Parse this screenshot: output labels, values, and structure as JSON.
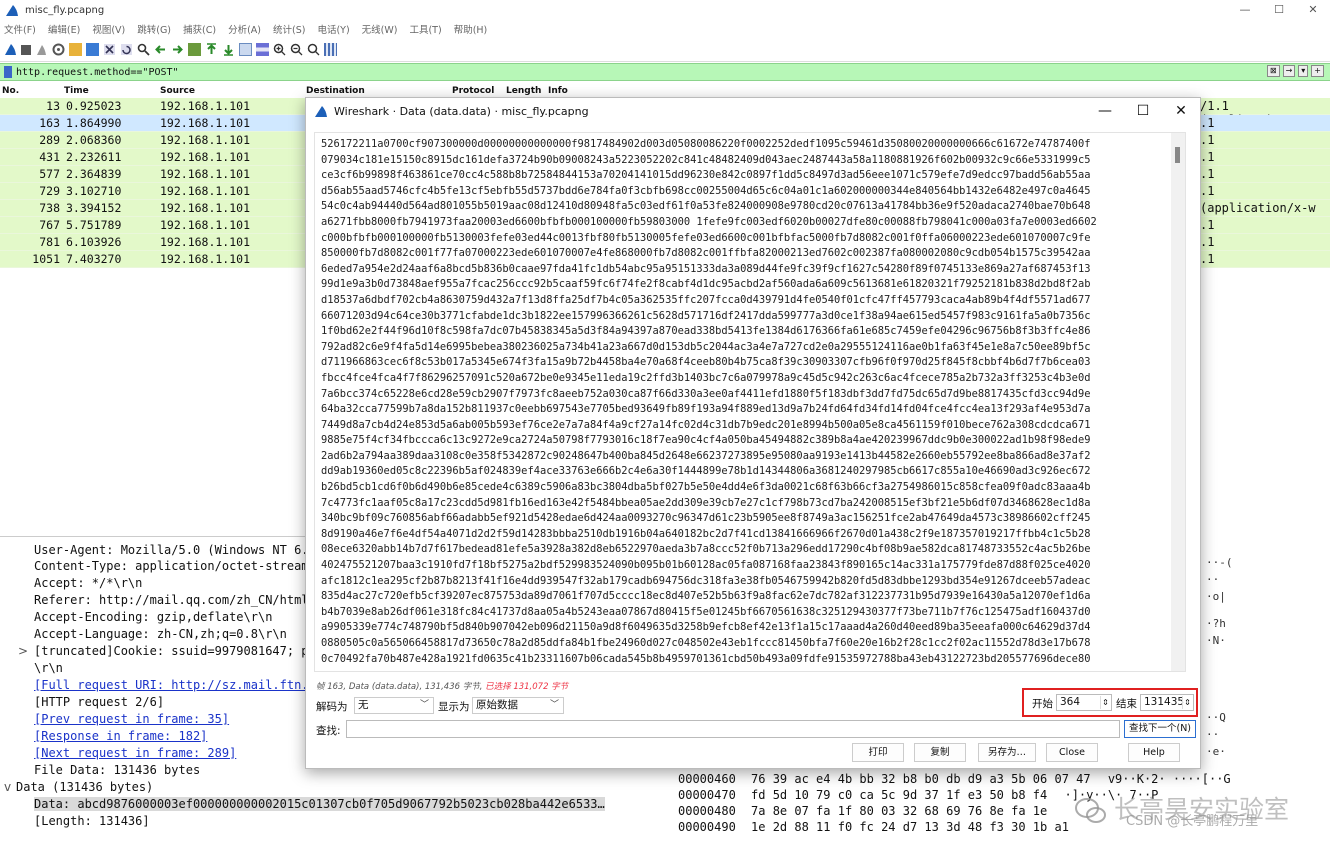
{
  "window": {
    "title": "misc_fly.pcapng",
    "controls": [
      "—",
      "☐",
      "✕"
    ]
  },
  "menu": [
    "文件(F)",
    "编辑(E)",
    "视图(V)",
    "跳转(G)",
    "捕获(C)",
    "分析(A)",
    "统计(S)",
    "电话(Y)",
    "无线(W)",
    "工具(T)",
    "帮助(H)"
  ],
  "filter": {
    "value": "http.request.method==\"POST\"",
    "right_buttons": [
      "⊠",
      "→",
      "▾",
      "+"
    ]
  },
  "columns": [
    "No.",
    "Time",
    "Source",
    "Destination",
    "Protocol",
    "Length",
    "Info"
  ],
  "packets": [
    {
      "no": "13",
      "time": "0.925023",
      "src": "192.168.1.101",
      "info": "/1.1  (application/"
    },
    {
      "no": "163",
      "time": "1.864990",
      "src": "192.168.1.101",
      "info": ".1"
    },
    {
      "no": "289",
      "time": "2.068360",
      "src": "192.168.1.101",
      "info": ".1"
    },
    {
      "no": "431",
      "time": "2.232611",
      "src": "192.168.1.101",
      "info": ".1"
    },
    {
      "no": "577",
      "time": "2.364839",
      "src": "192.168.1.101",
      "info": ".1"
    },
    {
      "no": "729",
      "time": "3.102710",
      "src": "192.168.1.101",
      "info": ".1"
    },
    {
      "no": "738",
      "time": "3.394152",
      "src": "192.168.1.101",
      "info": "  (application/x-w"
    },
    {
      "no": "767",
      "time": "5.751789",
      "src": "192.168.1.101",
      "info": ".1"
    },
    {
      "no": "781",
      "time": "6.103926",
      "src": "192.168.1.101",
      "info": ".1"
    },
    {
      "no": "1051",
      "time": "7.403270",
      "src": "192.168.1.101",
      "info": ".1"
    }
  ],
  "details": [
    {
      "text": "User-Agent: Mozilla/5.0 (Windows NT 6.1",
      "kind": "plain"
    },
    {
      "text": "Content-Type: application/octet-stream\\",
      "kind": "plain"
    },
    {
      "text": "Accept: */*\\r\\n",
      "kind": "plain"
    },
    {
      "text": "Referer: http://mail.qq.com/zh_CN/htmle",
      "kind": "plain"
    },
    {
      "text": "Accept-Encoding: gzip,deflate\\r\\n",
      "kind": "plain"
    },
    {
      "text": "Accept-Language: zh-CN,zh;q=0.8\\r\\n",
      "kind": "plain"
    },
    {
      "text": "[truncated]Cookie: ssuid=9979081647; p",
      "kind": "expand"
    },
    {
      "text": "\\r\\n",
      "kind": "plain"
    },
    {
      "text": "[Full request URI: http://sz.mail.ftn.q",
      "kind": "link"
    },
    {
      "text": "[HTTP request 2/6]",
      "kind": "plain"
    },
    {
      "text": "[Prev request in frame: 35]",
      "kind": "link"
    },
    {
      "text": "[Response in frame: 182]",
      "kind": "link"
    },
    {
      "text": "[Next request in frame: 289]",
      "kind": "link"
    },
    {
      "text": "File Data: 131436 bytes",
      "kind": "plain"
    },
    {
      "text": "Data (131436 bytes)",
      "kind": "section"
    },
    {
      "text": "Data: abcd9876000003ef000000000002015c01307cb0f705d9067792b5023cb028ba442e6533…",
      "kind": "selected"
    },
    {
      "text": "[Length: 131436]",
      "kind": "plain"
    }
  ],
  "hexdump": [
    {
      "offset": "00000460",
      "bytes": "76 39 ac e4 4b bb 32 b8  b0 db d9 a3 5b 06 07 47",
      "ascii": "v9··K·2· ····[··G"
    },
    {
      "offset": "00000470",
      "bytes": "fd 5d 10 79 c0 ca 5c 9d  37 1f e3 50 b8 f4 ",
      "ascii": "·]·y··\\· 7··P"
    },
    {
      "offset": "00000480",
      "bytes": "7a 8e 07 fa 1f 80 03 32  68 69 76 8e fa 1e ",
      "ascii": ""
    },
    {
      "offset": "00000490",
      "bytes": "1e 2d 88 11 f0 fc 24 d7  13 3d 48 f3 30 1b a1 ",
      "ascii": ""
    }
  ],
  "right_fragments": [
    "··-(",
    "··",
    "·o|",
    "·?h",
    "·N·",
    "··Q",
    "··",
    "·e·",
    "(·",
    "··",
    "··"
  ],
  "dialog": {
    "title": "Wireshark · Data (data.data) · misc_fly.pcapng",
    "controls": [
      "—",
      "☐",
      "✕"
    ],
    "hex_lines": [
      "526172211a0700cf907300000d00000000000000f9817484902d003d05080086220f0002252dedf1095c59461d35080020000000666c61672e74787400f",
      "079034c181e15150c8915dc161defa3724b90b09008243a5223052202c841c48482409d043aec2487443a58a1180881926f602b00932c9c66e5331999c5",
      "ce3cf6b99898f463861ce70cc4c588b8b72584844153a70204141015dd96230e842c0897f1dd5c8497d3ad56eee1071c579efe7d9edcc97badd56ab55aa",
      "d56ab55aad5746cfc4b5fe13cf5ebfb55d5737bdd6e784fa0f3cbfb698cc00255004d65c6c04a01c1a602000000344e840564bb1432e6482e497c0a4645",
      "54c0c4ab94440d564ad801055b5019aac08d12410d80948fa5c03edf61f0a53fe824000908e9780cd20c07613a41784bb36e9f520adaca2740bae70b648",
      "a6271fbb8000fb7941973faa20003ed6600bfbfb000100000fb59803000 1fefe9fc003edf6020b00027dfe80c00088fb798041c000a03fa7e0003ed6602",
      "c000bfbfb000100000fb5130003fefe03ed44c0013fbf80fb5130005fefe03ed6600c001bfbfac5000fb7d8082c001f0ffa06000223ede601070007c9fe",
      "850000fb7d8082c001f77fa07000223ede601070007e4fe868000fb7d8082c001ffbfa82000213ed7602c002387fa080002080c9cdb054b1575c39542aa",
      "6eded7a954e2d24aaf6a8bcd5b836b0caae97fda41fc1db54abc95a95151333da3a089d44fe9fc39f9cf1627c54280f89f0745133e869a27af687453f13",
      "99d1e9a3b0d73848aef955a7fcac256ccc92b5caaf59fc6f74fe2f8cabf4d1dc95acbd2af560ada6a609c5613681e61820321f79252181b838d2bd8f2ab",
      "d18537a6dbdf702cb4a8630759d432a7f13d8ffa25df7b4c05a362535ffc207fcca0d439791d4fe0540f01cfc47ff457793caca4ab89b4f4df5571ad677",
      "66071203d94c64ce30b3771cfabde1dc3b1822ee157996366261c5628d571716df2417dda599777a3d0ce1f38a94ae615ed5457f983c9161fa5a0b7356c",
      "1f0bd62e2f44f96d10f8c598fa7dc07b45838345a5d3f84a94397a870ead338bd5413fe1384d6176366fa61e685c7459efe04296c96756b8f3b3ffc4e86",
      "792ad82c6e9f4fa5d14e6995bebea380236025a734b41a23a667d0d153db5c2044ac3a4e7a727cd2e0a29555124116ae0b1fa63f45e1e8a7c50ee89bf5c",
      "d711966863cec6f8c53b017a5345e674f3fa15a9b72b4458ba4e70a68f4ceeb80b4b75ca8f39c30903307cfb96f0f970d25f845f8cbbf4b6d7f7b6cea03",
      "fbcc4fce4fca4f7f86296257091c520a672be0e9345e11eda19c2ffd3b1403bc7c6a079978a9c45d5c942c263c6ac4fcece785a2b732a3ff3253c4b3e0d",
      "7a6bcc374c65228e6cd28e59cb2907f7973fc8aeeb752a030ca87f66d330a3ee0af4411efd1880f5f183dbf3dd7fd75dc65d7d9be8817435cfd3cc94d9e",
      "64ba32cca77599b7a8da152b811937c0eebb697543e7705bed93649fb89f193a94f889ed13d9a7b24fd64fd34fd14fd04fce4fcc4ea13f293af4e953d7a",
      "7449d8a7cb4d24e853d5a6ab005b593ef76ce2e7a7a84f4a9cf27a14fc02d4c31db7b9edc201e8994b500a05e8ca4561159f010bece762a308cdcdca671",
      "9885e75f4cf34fbccca6c13c9272e9ca2724a50798f7793016c18f7ea90c4cf4a050ba45494882c389b8a4ae420239967ddc9b0e300022ad1b98f98ede9",
      "2ad6b2a794aa389daa3108c0e358f5342872c90248647b400ba845d2648e66237273895e95080aa9193e1413b44582e2660eb55792ee8ba866ad8e37af2",
      "dd9ab19360ed05c8c22396b5af024839ef4ace33763e666b2c4e6a30f1444899e78b1d14344806a3681240297985cb6617c855a10e46690ad3c926ec672",
      "b26bd5cb1cd6f0b6d490b6e85cede4c6389c5906a83bc3804dba5bf027b5e50e4dd4e6f3da0021c68f63b66cf3a2754986015c858cfea09f0adc83aaa4b",
      "7c4773fc1aaf05c8a17c23cdd5d981fb16ed163e42f5484bbea05ae2dd309e39cb7e27c1cf798b73cd7ba242008515ef3bf21e5b6df07d3468628ec1d8a",
      "340bc9bf09c760856abf66adabb5ef921d5428edae6d424aa0093270c96347d61c23b5905ee8f8749a3ac156251fce2ab47649da4573c38986602cff245",
      "8d9190a46e7f6e4df54a4071d2d2f59d14283bbba2510db1916b04a640182bc2d7f41cd13841666966f2670d01a438c2f9e187357019217ffbb4c1c5b28",
      "08ece6320abb14b7d7f617bedead81efe5a3928a382d8eb6522970aeda3b7a8ccc52f0b713a296edd17290c4bf08b9ae582dca81748733552c4ac5b26be",
      "402475521207baa3c1910fd7f18bf5275a2bdf529983524090b095b01b60128ac05fa087168faa23843f890165c14ac331a175779fde87d88f025ce4020",
      "afc1812c1ea295cf2b87b8213f41f16e4dd939547f32ab179cadb694756dc318fa3e38fb0546759942b820fd5d83dbbe1293bd354e91267dceeb57adeac",
      "835d4ac27c720efb5cf39207ec875753da89d7061f707d5cccc18ec8d407e52b5b63f9a8fac62e7dc782af312237731b95d7939e16430a5a12070ef1d6a",
      "b4b7039e8ab26df061e318fc84c41737d8aa05a4b5243eaa07867d80415f5e01245bf6670561638c325129430377f73be711b7f76c125475adf160437d0",
      "a9905339e774c748790bf5d840b907042eb096d21150a9d8f6049635d3258b9efcb8ef42e13f1a15c17aaad4a260d40eed89ba35eeafa000c64629d37d4",
      "0880505c0a565066458817d73650c78a2d85ddfa84b1fbe24960d027c048502e43eb1fccc81450bfa7f60e20e16b2f28c1cc2f02ac11552d78d3e17b678",
      "0c70492fa70b487e428a1921fd0635c41b23311607b06cada545b8b4959701361cbd50b493a09fdfe91535972788ba43eb43122723bd205577696dece80"
    ],
    "status_prefix": "帧 163, Data (data.data), 131,436 字节,",
    "status_red": "已选择 131,072 字节",
    "decode_label": "解码为",
    "decode_value": "无",
    "show_label": "显示为",
    "show_value": "原始数据",
    "start_label": "开始",
    "start_value": "364",
    "end_label": "结束",
    "end_value": "131435",
    "find_label": "查找:",
    "find_placeholder": "",
    "find_next": "查找下一个(N)",
    "buttons": {
      "print": "打印",
      "copy": "复制",
      "save_as": "另存为…",
      "close": "Close",
      "help": "Help"
    }
  },
  "watermark": {
    "text": "长亭昊安实验室",
    "sub": "CSDN @长亭鹏程万里"
  },
  "colors": {
    "filter_bg": "#b7f7b7",
    "row_bg": "#e3f9c9",
    "link": "#1a33c9",
    "highlight_box": "#e02020"
  }
}
